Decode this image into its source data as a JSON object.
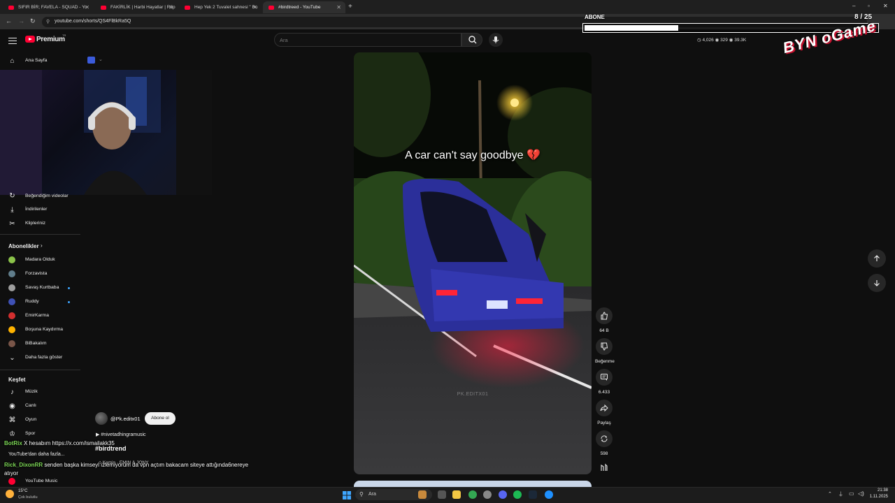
{
  "browser": {
    "tabs": [
      {
        "label": "SIFIR BİR; FAVELA - SQUAD - Yo"
      },
      {
        "label": "FAKİRLİK | Harbi Hayatlar | Röp"
      },
      {
        "label": "Hep Yek 2 Tuvalet sahnesi \" Bu"
      },
      {
        "label": "#birdtreed - YouTube"
      }
    ],
    "new_tab": "+",
    "url": "youtube.com/shorts/QS4FlBkRa5Q",
    "window_controls": [
      "–",
      "▫",
      "✕"
    ]
  },
  "header": {
    "brand": "Premium",
    "brand_suffix": "TR",
    "search_placeholder": "Ara"
  },
  "sidebar": {
    "home": "Ana Sayfa",
    "items_top": [
      {
        "label": "Beğendiğim videolar",
        "icon": "thumbs-up-icon"
      },
      {
        "label": "İndirilenler",
        "icon": "download-icon"
      },
      {
        "label": "Klipleriniz",
        "icon": "scissors-icon"
      }
    ],
    "subscriptions_heading": "Abonelikler",
    "subscriptions": [
      {
        "label": "Madara Olduk",
        "color": "#8bc34a",
        "dot": false
      },
      {
        "label": "Forzavista",
        "color": "#607d8b",
        "dot": false
      },
      {
        "label": "Savaş Kurtbaba",
        "color": "#9e9e9e",
        "dot": true
      },
      {
        "label": "Ruddy",
        "color": "#3f51b5",
        "dot": true
      },
      {
        "label": "EmirKarma",
        "color": "#d32f2f",
        "dot": false
      },
      {
        "label": "Boşuna Kaydırma",
        "color": "#ffb300",
        "dot": false
      },
      {
        "label": "BiBakalım",
        "color": "#795548",
        "dot": false
      }
    ],
    "show_more": "Daha fazla göster",
    "explore_heading": "Keşfet",
    "explore": [
      {
        "label": "Müzik",
        "icon": "music-icon"
      },
      {
        "label": "Canlı",
        "icon": "live-icon"
      },
      {
        "label": "Oyun",
        "icon": "gaming-icon"
      },
      {
        "label": "Spor",
        "icon": "trophy-icon"
      }
    ],
    "more_from_heading": "YouTube'dan daha fazla...",
    "youtube_music": "YouTube Music"
  },
  "video": {
    "caption": "A car can't say goodbye 💔",
    "watermark": "PK.EDITX01",
    "channel": "@Pk.editx01",
    "subscribe": "Abone ol",
    "music_tag": "#nivetadhingramusic",
    "title": "#birdtrend",
    "sound": "Kamin · EMIN & JONY"
  },
  "actions": {
    "likes": "64 B",
    "dislike": "Beğenme",
    "comments": "6.433",
    "share": "Paylaş",
    "remix": "598"
  },
  "chat": [
    {
      "nick": "BotRix",
      "nick_color": "#7ed957",
      "text": "X hesabım https://x.com/ismailakk35"
    },
    {
      "nick": "Rick_DixonRR",
      "nick_color": "#7ed957",
      "text": "senden başka kimseyi izlemiyorum da vpn açtım bakacam siteye attığında6nereye"
    },
    {
      "nick": "",
      "nick_color": "#ffffff",
      "text": "atıyor"
    }
  ],
  "stream_overlay": {
    "goal_title": "ABONE",
    "goal_count": "8 / 25",
    "goal_progress": 0.32,
    "stats": [
      "4,026",
      "329",
      "39.3K"
    ],
    "logo": "BYN oGame"
  },
  "taskbar": {
    "weather_temp": "15°C",
    "weather_desc": "Çok bulutlu",
    "search": "Ara",
    "time": "21:38",
    "date": "1.11.2025"
  }
}
